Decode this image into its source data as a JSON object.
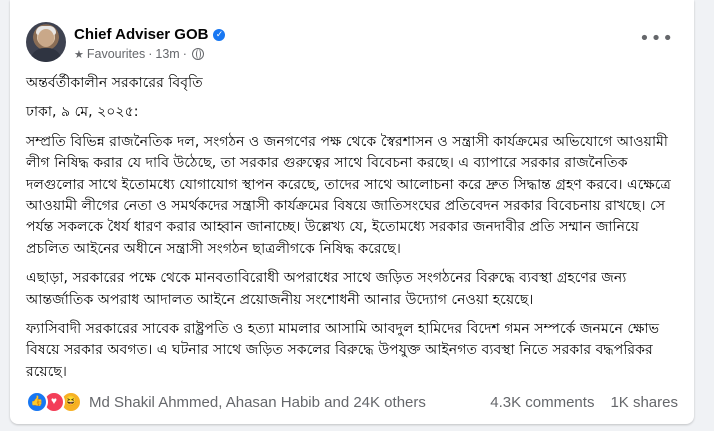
{
  "author": {
    "name": "Chief Adviser GOB"
  },
  "meta": {
    "audience": "Favourites",
    "time": "13m"
  },
  "post": {
    "title": "অন্তর্বর্তীকালীন সরকারের বিবৃতি",
    "dateline": "ঢাকা, ৯ মে, ২০২৫:",
    "paragraphs": [
      "সম্প্রতি বিভিন্ন রাজনৈতিক দল, সংগঠন ও জনগণের পক্ষ থেকে স্বৈরশাসন ও সন্ত্রাসী কার্যক্রমের অভিযোগে আওয়ামী লীগ নিষিদ্ধ করার যে দাবি উঠেছে, তা সরকার গুরুত্বের সাথে বিবেচনা করছে। এ ব্যাপারে সরকার রাজনৈতিক দলগুলোর সাথে ইতোমধ্যে যোগাযোগ স্থাপন করেছে, তাদের সাথে আলোচনা করে দ্রুত সিদ্ধান্ত গ্রহণ করবে। এক্ষেত্রে আওয়ামী লীগের নেতা ও সমর্থকদের সন্ত্রাসী কার্যক্রমের বিষয়ে জাতিসংঘের প্রতিবেদন সরকার বিবেচনায় রাখছে। সে পর্যন্ত সকলকে ধৈর্য ধারণ করার আহ্বান জানাচ্ছে। উল্লেখ্য যে, ইতোমধ্যে সরকার জনদাবীর প্রতি সম্মান জানিয়ে প্রচলিত আইনের অধীনে সন্ত্রাসী সংগঠন ছাত্রলীগকে নিষিদ্ধ করেছে।",
      "এছাড়া, সরকারের পক্ষে থেকে মানবতাবিরোধী অপরাধের সাথে জড়িত সংগঠনের বিরুদ্ধে ব্যবস্থা গ্রহণের জন্য আন্তর্জাতিক অপরাধ আদালত আইনে প্রয়োজনীয় সংশোধনী আনার উদ্যোগ নেওয়া হয়েছে।",
      "ফ্যাসিবাদী সরকারের সাবেক রাষ্ট্রপতি ও হত্যা মামলার আসামি আবদুল হামিদের বিদেশ গমন সম্পর্কে জনমনে ক্ষোভ বিষয়ে সরকার অবগত। এ ঘটনার সাথে জড়িত সকলের বিরুদ্ধে উপযুক্ত আইনগত ব্যবস্থা নিতে সরকার বদ্ধপরিকর রয়েছে।"
    ]
  },
  "reactions": {
    "summary": "Md Shakil Ahmmed, Ahasan Habib and 24K others",
    "comments": "4.3K comments",
    "shares": "1K shares"
  },
  "icons": [
    "verified-badge-icon",
    "star-icon",
    "globe-icon",
    "more-options-icon",
    "like-reaction-icon",
    "love-reaction-icon",
    "haha-reaction-icon"
  ],
  "colors": {
    "accent": "#1877f2",
    "secondary_text": "#65676b",
    "background": "#f0f2f5"
  }
}
